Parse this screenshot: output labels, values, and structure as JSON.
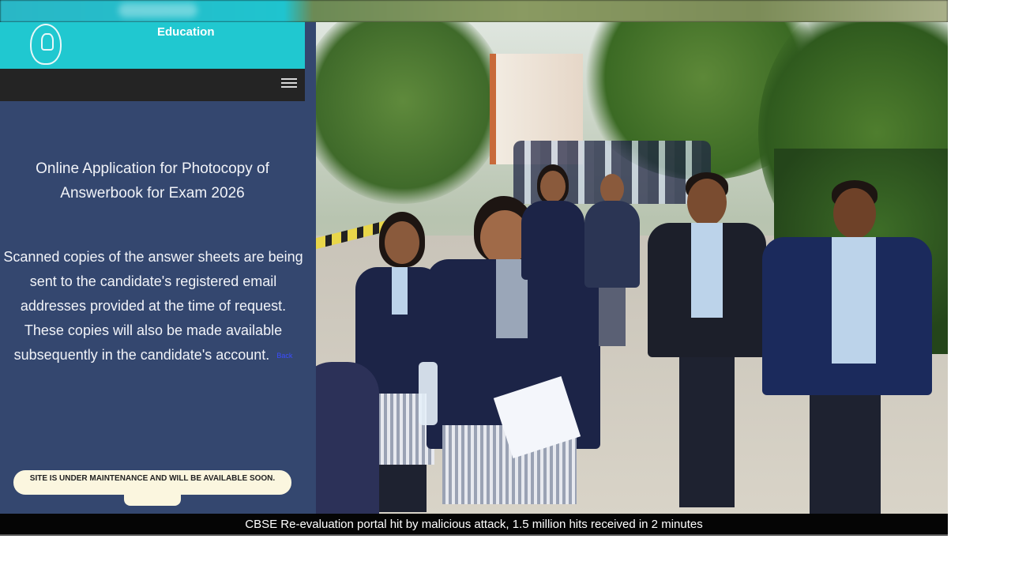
{
  "panel": {
    "header_label": "Education",
    "title": "Online Application for Photocopy of Answerbook for Exam 2026",
    "body": "Scanned copies of the answer sheets are being sent to the candidate's registered email addresses provided at the time of request. These copies will also be made available subsequently in the candidate's account.",
    "link_text": "Back",
    "notice": "SITE IS UNDER MAINTENANCE AND WILL BE AVAILABLE SOON."
  },
  "caption": "CBSE Re-evaluation portal hit by malicious attack, 1.5 million hits received in 2 minutes",
  "icons": {
    "menu": "hamburger-menu-icon",
    "logo": "cbse-emblem"
  },
  "colors": {
    "panel_bg": "#34476f",
    "header_bg": "#20c8d0",
    "navbar_bg": "#242424",
    "caption_bg": "#050505",
    "notice_bg": "#fbf6df"
  }
}
